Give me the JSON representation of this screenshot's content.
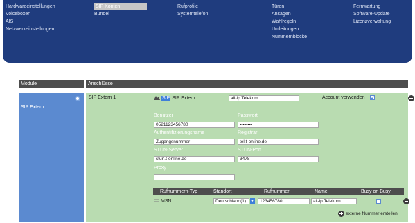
{
  "nav": {
    "col1": [
      "Hardwareeinstellungen",
      "Voiceboxen",
      "AIS",
      "Netzwerkeinstellungen"
    ],
    "col2": [
      "SIP Konten",
      "Bündel"
    ],
    "col3": [
      "Rufprofile",
      "Systemtelefon"
    ],
    "col4": [
      "Türen",
      "Ansagen",
      "Wahlregeln",
      "Umleitungen",
      "Nummernblöcke"
    ],
    "col5": [
      "Fernwartung",
      "Software-Update",
      "Lizenzverwaltung"
    ]
  },
  "headers": {
    "module": "Module",
    "anschluesse": "Anschlüsse"
  },
  "module": {
    "name": "SIP Extern"
  },
  "account": {
    "title": "SIP Extern 1",
    "type_badge": "SIP",
    "type_label": "SIP Extern",
    "provider_value": "all-ip Telekom",
    "use_account_label": "Account verwenden",
    "use_account_checked": true
  },
  "fields": {
    "benutzer_label": "Benutzer",
    "benutzer_value": "0521123456780",
    "passwort_label": "Passwort",
    "passwort_value": "••••••••",
    "auth_label": "Authentifizierungsname",
    "auth_value": "Zugangsnummer",
    "registrar_label": "Registrar",
    "registrar_value": "tel.t-online.de",
    "stun_server_label": "STUN-Server",
    "stun_server_value": "stun.t-online.de",
    "stun_port_label": "STUN-Port",
    "stun_port_value": "3478",
    "proxy_label": "Proxy",
    "proxy_value": ""
  },
  "numbers_table": {
    "columns": [
      "Rufnummern-Typ",
      "Standort",
      "Rufnummer",
      "Name",
      "Busy on Busy"
    ],
    "rows": [
      {
        "type": "MSN",
        "standort": "Deutschland(1)",
        "rufnummer": "123456780",
        "name": "all-ip Telekom",
        "busy_on_busy": false
      }
    ],
    "add_label": "externe Nummer erstellen"
  }
}
